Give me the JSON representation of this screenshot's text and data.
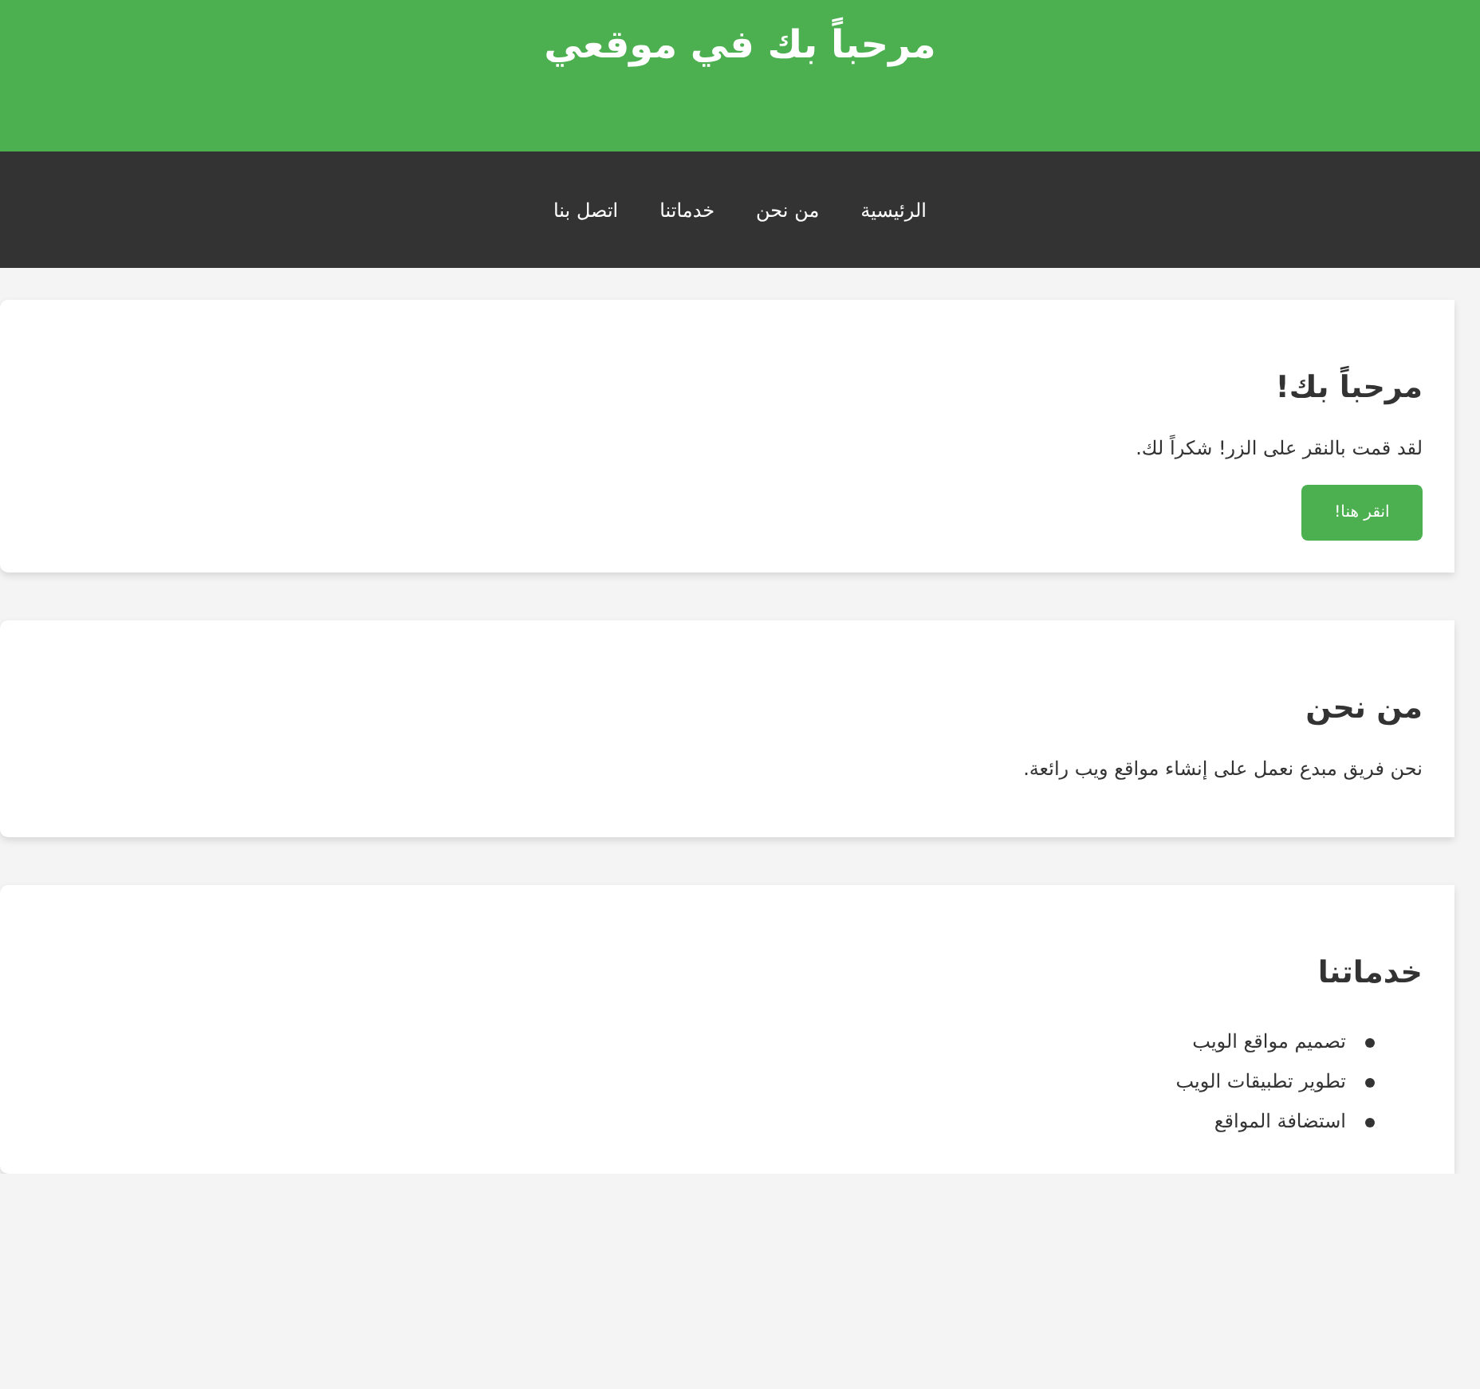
{
  "header": {
    "title": "مرحباً بك في موقعي"
  },
  "nav": {
    "links": [
      "الرئيسية",
      "من نحن",
      "خدماتنا",
      "اتصل بنا"
    ]
  },
  "sections": [
    {
      "kind": "welcome",
      "title": "مرحباً بك!",
      "text": "لقد قمت بالنقر على الزر! شكراً لك.",
      "button": "انقر هنا!"
    },
    {
      "kind": "about",
      "title": "من نحن",
      "text": "نحن فريق مبدع نعمل على إنشاء مواقع ويب رائعة."
    },
    {
      "kind": "services",
      "title": "خدماتنا",
      "items": [
        "تصميم مواقع الويب",
        "تطوير تطبيقات الويب",
        "استضافة المواقع"
      ]
    }
  ]
}
